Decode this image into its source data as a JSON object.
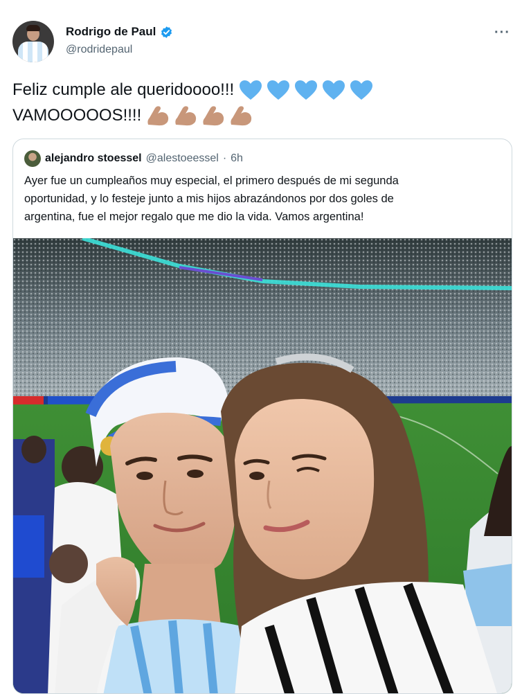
{
  "author": {
    "display_name": "Rodrigo de Paul",
    "handle": "@rodridepaul",
    "verified": true,
    "avatar_icon": "profile-photo"
  },
  "more_icon": "more-options-icon",
  "more_label": "···",
  "tweet": {
    "line1": "Feliz cumple ale queridoooo!!!",
    "line2": "VAMOOOOOS!!!!",
    "heart_emoji": "light-blue-heart",
    "heart_count": 5,
    "arm_emoji": "flexed-biceps",
    "arm_count": 4
  },
  "quoted": {
    "display_name": "alejandro stoessel",
    "handle": "@alestoeessel",
    "separator": "·",
    "time": "6h",
    "text_lines": [
      "Ayer fue un cumpleaños muy especial, el primero después de mi segunda",
      "oportunidad, y lo festeje junto a mis hijos abrazándonos por dos goles de",
      "argentina, fue el mejor regalo que me dio la vida. Vamos argentina!"
    ],
    "photo": "stadium-selfie-photo"
  },
  "colors": {
    "text": "#0f1419",
    "secondary": "#536471",
    "verified": "#1d9bf0",
    "heart": "#5fb2f0",
    "border": "#cfd9de"
  }
}
